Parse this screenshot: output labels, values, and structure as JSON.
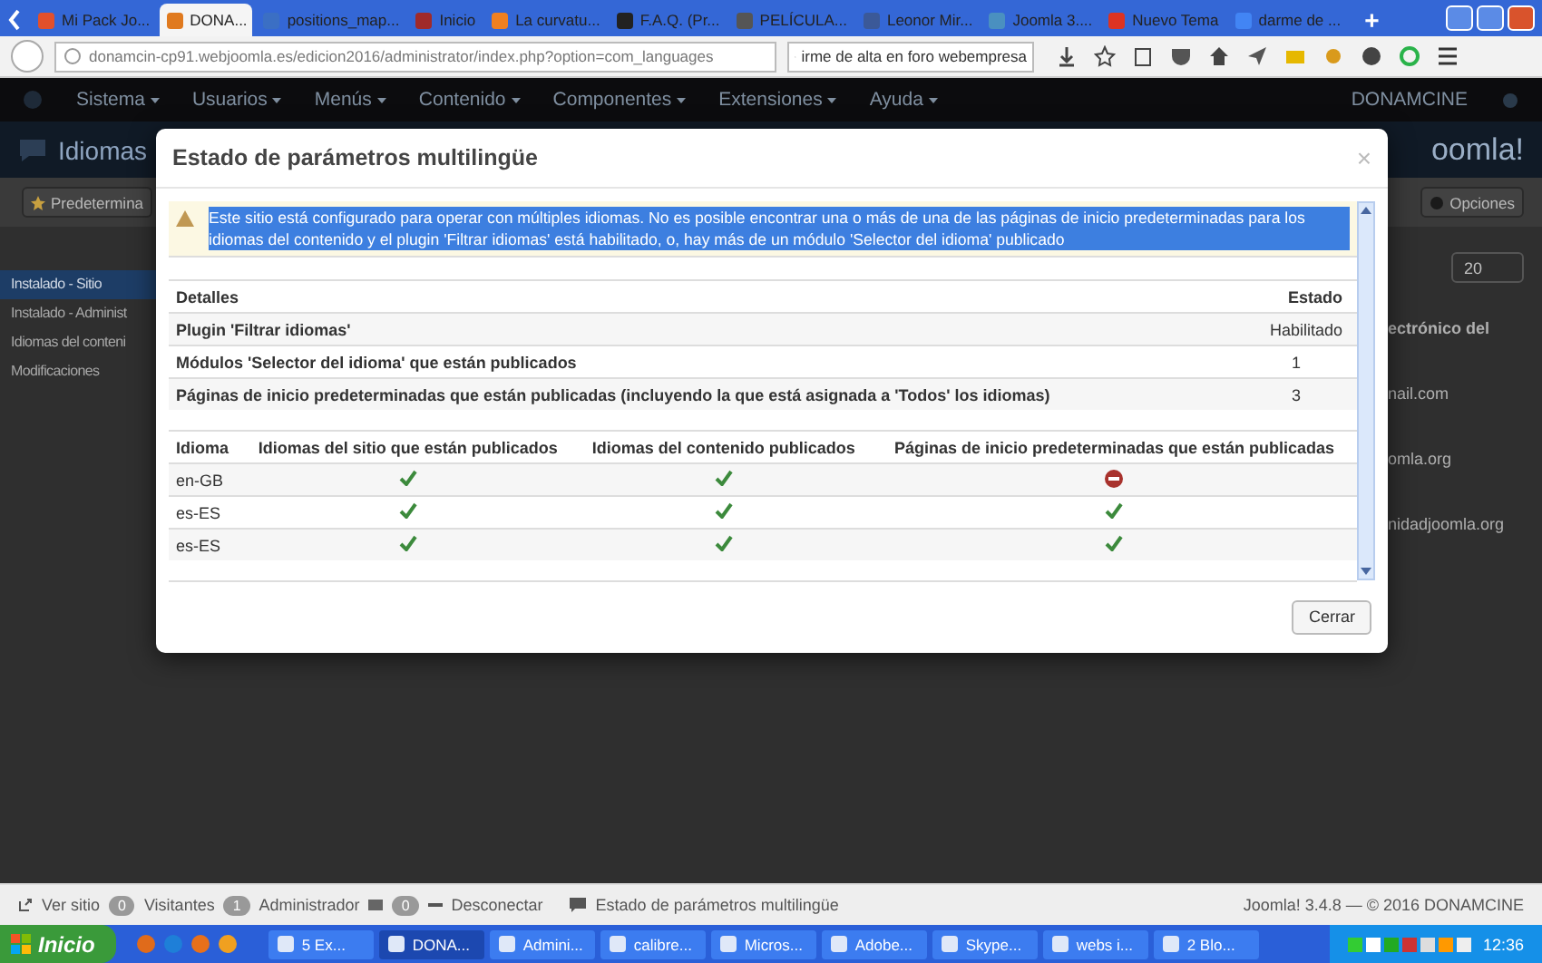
{
  "browser": {
    "tabs": [
      {
        "label": "Mi Pack Jo...",
        "selected": false
      },
      {
        "label": "DONA...",
        "selected": true
      },
      {
        "label": "positions_map...",
        "selected": false
      },
      {
        "label": "Inicio",
        "selected": false
      },
      {
        "label": "La curvatu...",
        "selected": false
      },
      {
        "label": "F.A.Q. (Pr...",
        "selected": false
      },
      {
        "label": "PELÍCULA...",
        "selected": false
      },
      {
        "label": "Leonor Mir...",
        "selected": false
      },
      {
        "label": "Joomla 3....",
        "selected": false
      },
      {
        "label": "Nuevo Tema",
        "selected": false
      },
      {
        "label": "darme de ...",
        "selected": false
      }
    ],
    "new_tab": "+",
    "url": "donamcin-cp91.webjoomla.es/edicion2016/administrator/index.php?option=com_languages",
    "search": "irme de alta en foro webempresa"
  },
  "admin": {
    "menu": [
      "Sistema",
      "Usuarios",
      "Menús",
      "Contenido",
      "Componentes",
      "Extensiones",
      "Ayuda"
    ],
    "user": "DONAMCINE",
    "page_title": "Idiomas",
    "logo": "oomla!",
    "toolbar": {
      "default_button": "Predetermina",
      "options_button": "Opciones"
    },
    "sidebar": [
      {
        "label": "Instalado - Sitio",
        "selected": true
      },
      {
        "label": "Instalado - Administ",
        "selected": false
      },
      {
        "label": "Idiomas del conteni",
        "selected": false
      },
      {
        "label": "Modificaciones",
        "selected": false
      }
    ],
    "list_limit": "20",
    "column_header": "ectrónico del",
    "cells": [
      "nail.com",
      "omla.org",
      "nidadjoomla.org"
    ]
  },
  "modal": {
    "title": "Estado de parámetros multilingüe",
    "close": "×",
    "alert": {
      "text": "Este sitio está configurado para operar con múltiples idiomas. No es posible encontrar una o más de una de las páginas de inicio predeterminadas para los idiomas del contenido y el plugin 'Filtrar idiomas' está habilitado, o, hay más de un módulo 'Selector del idioma' publicado",
      "highlighted": true
    },
    "details": {
      "columns": [
        "Detalles",
        "Estado"
      ],
      "rows": [
        {
          "label": "Plugin 'Filtrar idiomas'",
          "value": "Habilitado"
        },
        {
          "label": "Módulos 'Selector del idioma' que están publicados",
          "value": "1"
        },
        {
          "label": "Páginas de inicio predeterminadas que están publicadas (incluyendo la que está asignada a 'Todos' los idiomas)",
          "value": "3"
        }
      ]
    },
    "languages": {
      "columns": [
        "Idioma",
        "Idiomas del sitio que están publicados",
        "Idiomas del contenido publicados",
        "Páginas de inicio predeterminadas que están publicadas"
      ],
      "rows": [
        {
          "language": "en-GB",
          "site_published": true,
          "content_published": true,
          "home_published": false
        },
        {
          "language": "es-ES",
          "site_published": true,
          "content_published": true,
          "home_published": true
        },
        {
          "language": "es-ES",
          "site_published": true,
          "content_published": true,
          "home_published": true
        }
      ]
    },
    "close_button": "Cerrar"
  },
  "status_bar": {
    "view_site": "Ver sitio",
    "visitors_count": "0",
    "visitors": "Visitantes",
    "admins_count": "1",
    "admins": "Administrador",
    "messages_count": "0",
    "logout": "Desconectar",
    "multilang": "Estado de parámetros multilingüe",
    "version": "Joomla! 3.4.8 — © 2016 DONAMCINE"
  },
  "taskbar": {
    "start": "Inicio",
    "tasks": [
      {
        "label": "5 Ex...",
        "selected": false
      },
      {
        "label": "DONA...",
        "selected": true
      },
      {
        "label": "Admini...",
        "selected": false
      },
      {
        "label": "calibre...",
        "selected": false
      },
      {
        "label": "Micros...",
        "selected": false
      },
      {
        "label": "Adobe...",
        "selected": false
      },
      {
        "label": "Skype...",
        "selected": false
      },
      {
        "label": "webs i...",
        "selected": false
      },
      {
        "label": "2 Blo...",
        "selected": false
      }
    ],
    "clock": "12:36"
  }
}
